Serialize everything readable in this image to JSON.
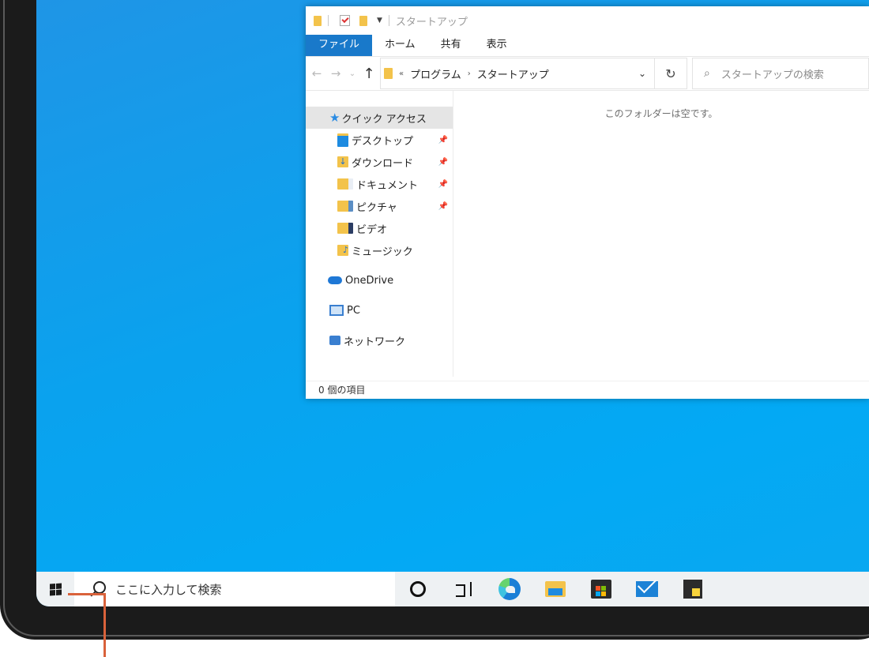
{
  "explorer": {
    "title": "スタートアップ",
    "ribbon_tabs": [
      "ファイル",
      "ホーム",
      "共有",
      "表示"
    ],
    "breadcrumb": [
      "«",
      "プログラム",
      "スタートアップ"
    ],
    "search_placeholder": "スタートアップの検索",
    "quick_access": "クイック アクセス",
    "nav_items": [
      {
        "label": "デスクトップ",
        "pinned": true,
        "icon": "desktop-icon"
      },
      {
        "label": "ダウンロード",
        "pinned": true,
        "icon": "download-icon"
      },
      {
        "label": "ドキュメント",
        "pinned": true,
        "icon": "document-icon"
      },
      {
        "label": "ピクチャ",
        "pinned": true,
        "icon": "picture-icon"
      },
      {
        "label": "ビデオ",
        "pinned": false,
        "icon": "video-icon"
      },
      {
        "label": "ミュージック",
        "pinned": false,
        "icon": "music-icon"
      }
    ],
    "onedrive": "OneDrive",
    "pc": "PC",
    "network": "ネットワーク",
    "empty_message": "このフォルダーは空です。",
    "status": "0 個の項目"
  },
  "taskbar": {
    "search_placeholder": "ここに入力して検索",
    "apps": [
      "cortana-icon",
      "task-view-icon",
      "edge-icon",
      "file-explorer-icon",
      "store-icon",
      "mail-icon",
      "sticky-notes-icon"
    ]
  },
  "colors": {
    "accent": "#1979ca",
    "desktop": "#03a9f4",
    "callout": "#d9623b"
  }
}
